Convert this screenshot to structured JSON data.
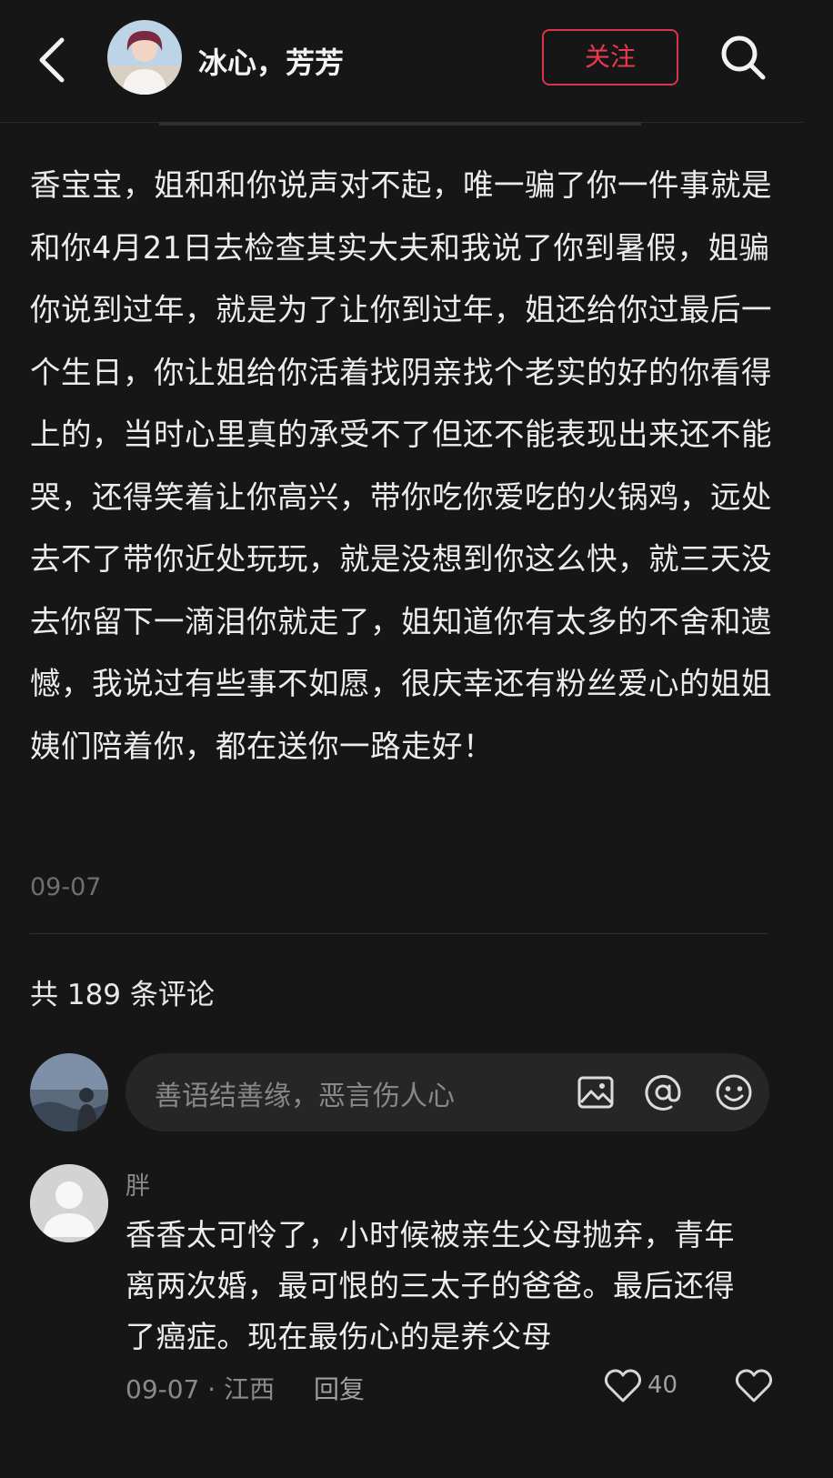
{
  "header": {
    "author_name": "冰心，芳芳",
    "follow_label": "关注",
    "icons": [
      "back-arrow-icon",
      "search-icon"
    ]
  },
  "post": {
    "text": "香宝宝，姐和和你说声对不起，唯一骗了你一件事就是和你4月21日去检查其实大夫和我说了你到暑假，姐骗你说到过年，就是为了让你到过年，姐还给你过最后一个生日，你让姐给你活着找阴亲找个老实的好的你看得上的，当时心里真的承受不了但还不能表现出来还不能哭，还得笑着让你高兴，带你吃你爱吃的火锅鸡，远处去不了带你近处玩玩，就是没想到你这么快，就三天没去你留下一滴泪你就走了，姐知道你有太多的不舍和遗憾，我说过有些事不如愿，很庆幸还有粉丝爱心的姐姐姨们陪着你，都在送你一路走好！",
    "date": "09-07"
  },
  "comments_header": {
    "count_text": "共 189 条评论"
  },
  "comment_input": {
    "placeholder": "善语结善缘，恶言伤人心",
    "icons": [
      "image-icon",
      "at-icon",
      "emoji-icon"
    ]
  },
  "comments": [
    {
      "user": "胖",
      "text": "香香太可怜了，小时候被亲生父母抛弃，青年离两次婚，最可恨的三太子的爸爸。最后还得了癌症。现在最伤心的是养父母",
      "date": "09-07",
      "location": "江西",
      "reply_label": "回复",
      "like_count": "40"
    }
  ],
  "colors": {
    "background": "#161616",
    "accent": "#e8394f",
    "text": "#ececec",
    "muted": "#8a8a8a"
  }
}
